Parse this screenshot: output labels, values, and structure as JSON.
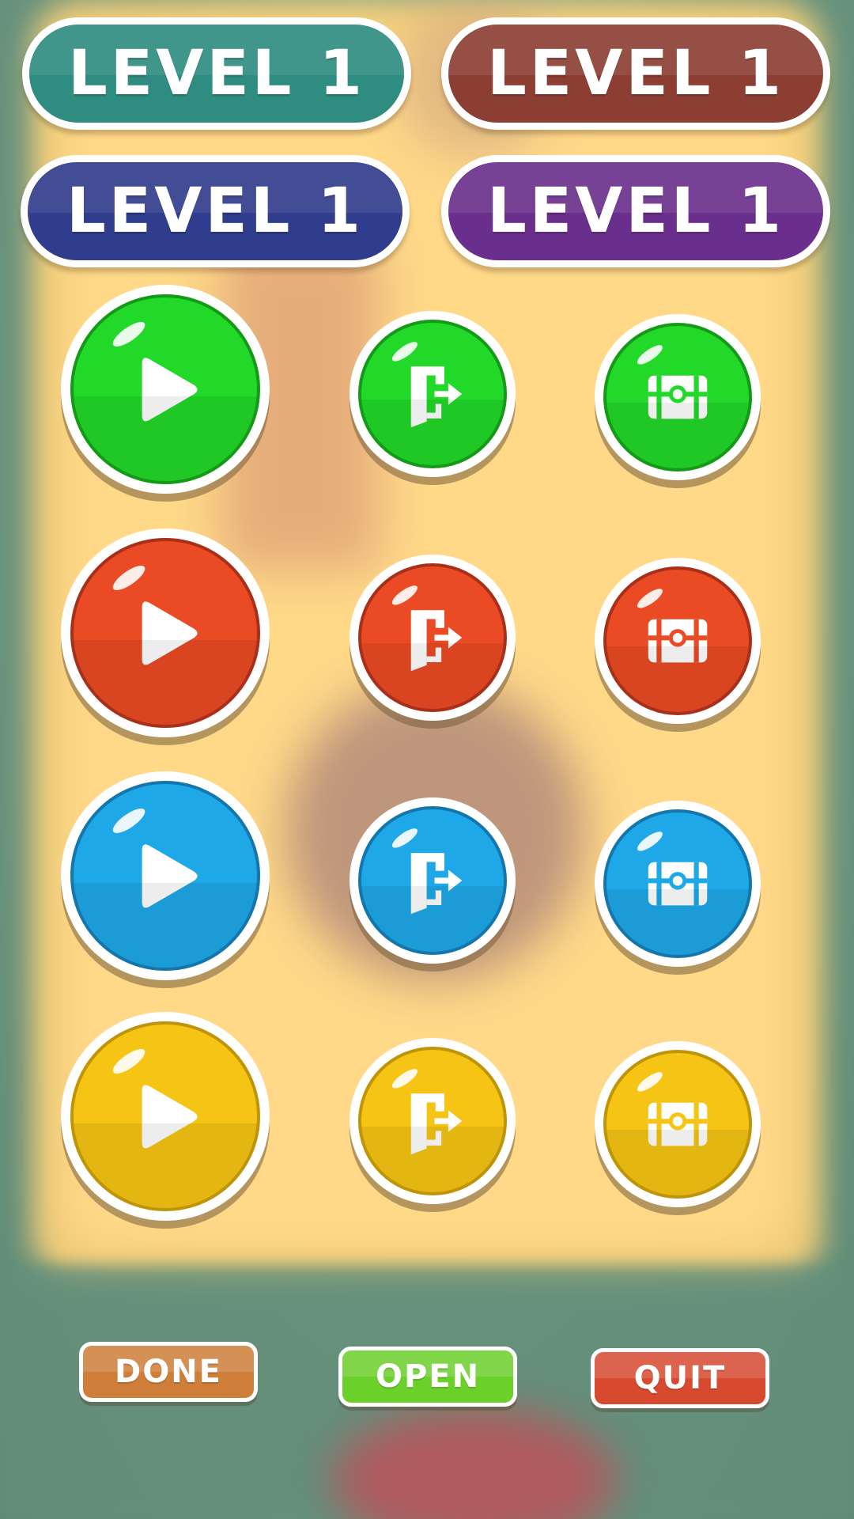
{
  "level_buttons": [
    {
      "label": "LEVEL 1",
      "color": "#2f8c80"
    },
    {
      "label": "LEVEL 1",
      "color": "#8c3e32"
    },
    {
      "label": "LEVEL 1",
      "color": "#303c8c"
    },
    {
      "label": "LEVEL 1",
      "color": "#6a2f8c"
    }
  ],
  "round_buttons": [
    {
      "color_name": "green",
      "fill": "#22d828",
      "border": "#149a18",
      "icons": [
        "play-icon",
        "exit-door-icon",
        "chest-icon"
      ]
    },
    {
      "color_name": "red",
      "fill": "#ea4a24",
      "border": "#a8301a",
      "icons": [
        "play-icon",
        "exit-door-icon",
        "chest-icon"
      ]
    },
    {
      "color_name": "blue",
      "fill": "#1fa8e8",
      "border": "#1476ab",
      "icons": [
        "play-icon",
        "exit-door-icon",
        "chest-icon"
      ]
    },
    {
      "color_name": "yellow",
      "fill": "#f6c414",
      "border": "#bf9406",
      "icons": [
        "play-icon",
        "exit-door-icon",
        "chest-icon"
      ]
    }
  ],
  "bottom_buttons": {
    "done": {
      "label": "DONE",
      "color": "#cf7e3a"
    },
    "open": {
      "label": "OPEN",
      "color": "#6cd02a"
    },
    "quit": {
      "label": "QUIT",
      "color": "#d74a30"
    }
  }
}
